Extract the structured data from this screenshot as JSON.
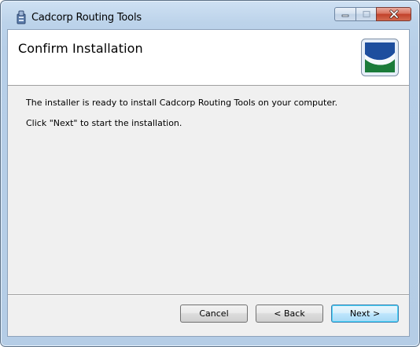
{
  "window": {
    "title": "Cadcorp Routing Tools",
    "icon": "installer-icon"
  },
  "caption_buttons": {
    "minimize_icon": "minimize-icon",
    "maximize_icon": "maximize-icon",
    "close_icon": "close-icon"
  },
  "banner": {
    "title": "Confirm Installation",
    "logo": "cadcorp-logo",
    "logo_colors": {
      "blue": "#1d4e9e",
      "green": "#1b7b3a",
      "light": "#e6eef8"
    }
  },
  "content": {
    "line1": "The installer is ready to install Cadcorp Routing Tools on your computer.",
    "line2": "Click \"Next\" to start the installation."
  },
  "buttons": {
    "cancel": "Cancel",
    "back": "< Back",
    "next": "Next >"
  }
}
